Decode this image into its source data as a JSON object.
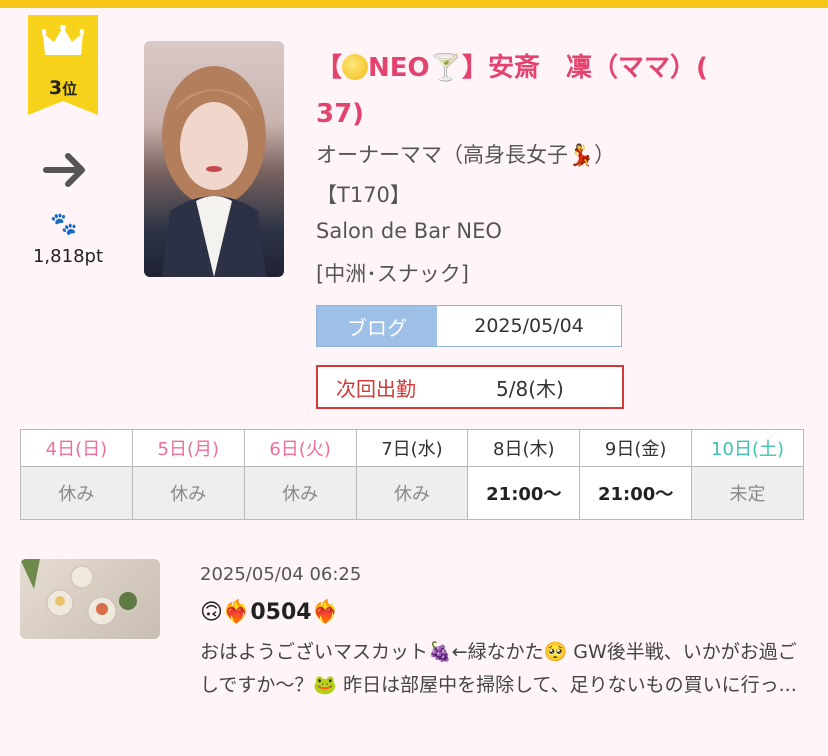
{
  "rank": {
    "number": "3",
    "suffix": "位"
  },
  "points": "1,818pt",
  "profile": {
    "name_prefix": "【",
    "name_neo": "NEO",
    "name_glass": "🍸",
    "name_main": "】安斎　凜（ママ）(",
    "name_age": "37)",
    "role": "オーナーママ（高身長女子💃）",
    "height": "【T170】",
    "shop": "Salon de Bar NEO",
    "area": "[中洲･スナック]"
  },
  "blog": {
    "label": "ブログ",
    "date": "2025/05/04"
  },
  "next_shift": {
    "label": "次回出勤",
    "date": "5/8(木)"
  },
  "schedule": [
    {
      "day": "4日(日)",
      "time": "休み",
      "day_type": "sun",
      "off": true
    },
    {
      "day": "5日(月)",
      "time": "休み",
      "day_type": "hol",
      "off": true
    },
    {
      "day": "6日(火)",
      "time": "休み",
      "day_type": "hol",
      "off": true
    },
    {
      "day": "7日(水)",
      "time": "休み",
      "day_type": "norm",
      "off": true
    },
    {
      "day": "8日(木)",
      "time": "21:00〜",
      "day_type": "norm",
      "off": false
    },
    {
      "day": "9日(金)",
      "time": "21:00〜",
      "day_type": "norm",
      "off": false
    },
    {
      "day": "10日(土)",
      "time": "未定",
      "day_type": "sat",
      "off": true
    }
  ],
  "post": {
    "datetime": "2025/05/04 06:25",
    "title": "🙃❤️‍🔥0504❤️‍🔥",
    "body": "おはようございマスカット🍇←緑なかた🥺 GW後半戦、いかがお過ごしですか〜？🐸 昨日は部屋中を掃除して、足りないもの買いに行っ..."
  },
  "colors": {
    "accent_pink": "#e3446f",
    "ribbon_yellow": "#f7d21b",
    "blog_blue": "#9ebfe6",
    "next_red": "#d23a3a",
    "sunday_pink": "#ee6f98",
    "saturday_teal": "#3fc0b7"
  }
}
